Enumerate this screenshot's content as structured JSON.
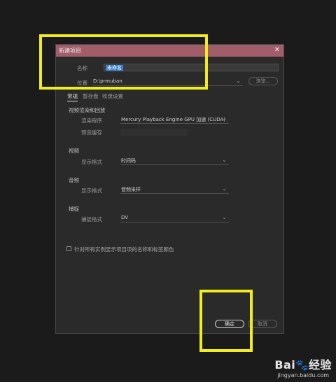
{
  "dialog": {
    "title": "新建项目",
    "close_glyph": "✕",
    "name_label": "名称",
    "name_value": "未命名",
    "location_label": "位置",
    "location_value": "D:\\prmuban",
    "browse_label": "浏览...",
    "tabs": [
      "常规",
      "暂存盘",
      "收录设置"
    ],
    "sections": {
      "video_render": {
        "title": "视频渲染和回放",
        "renderer_label": "渲染程序",
        "renderer_value": "Mercury Playback Engine GPU 加速 (CUDA)",
        "preview_cache_label": "预览缓存"
      },
      "video": {
        "title": "视频",
        "display_format_label": "显示格式",
        "display_format_value": "时间码"
      },
      "audio": {
        "title": "音频",
        "display_format_label": "显示格式",
        "display_format_value": "音频采样"
      },
      "capture": {
        "title": "捕捉",
        "capture_format_label": "捕捉格式",
        "capture_format_value": "DV"
      }
    },
    "checkbox_label": "针对所有实例显示项目项的名称和标签颜色",
    "ok_label": "确定",
    "cancel_label": "取消"
  },
  "watermark": {
    "logo": "Bai",
    "logo_suffix": "经验",
    "url": "jingyan.baidu.com"
  },
  "colors": {
    "titlebar": "#a25d6a",
    "highlight": "#f1ec1b",
    "selection": "#3c7fd4",
    "background": "#1b1b1b",
    "dialog": "#2a2a2a"
  },
  "icons": [
    "close-icon",
    "chevron-down-icon",
    "checkbox-icon",
    "paw-icon"
  ]
}
